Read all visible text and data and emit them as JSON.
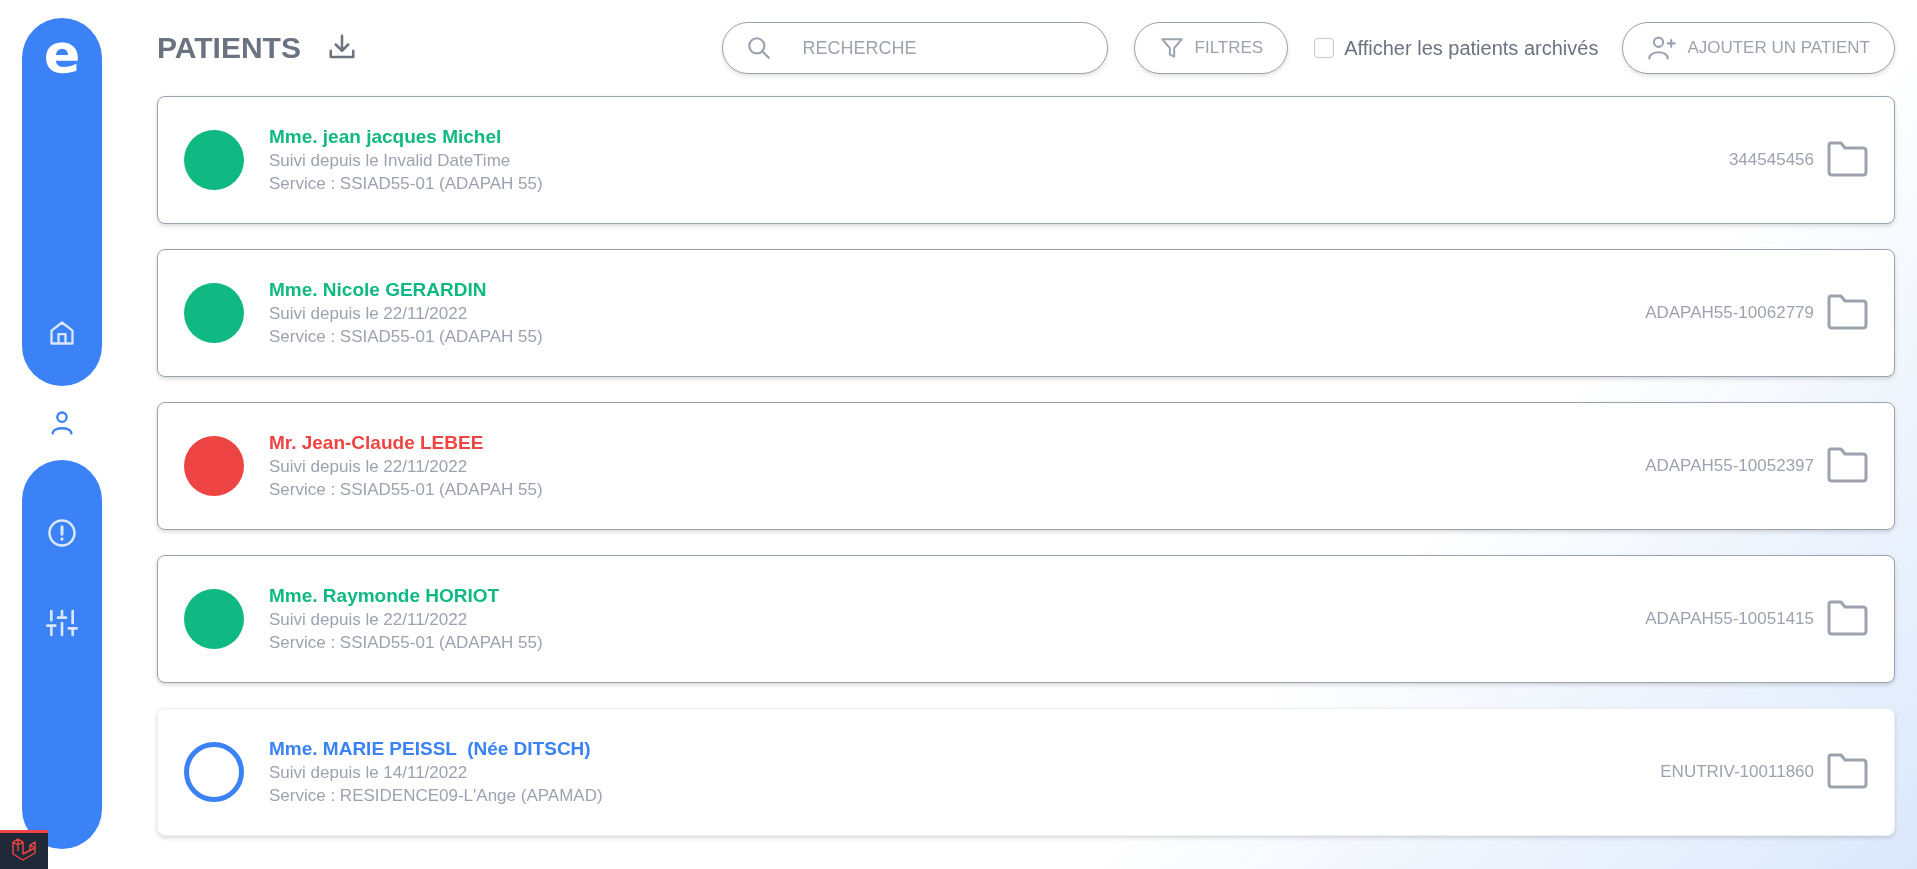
{
  "sidebar": {
    "logo": "e",
    "items": [
      {
        "kind": "home",
        "selected": false
      },
      {
        "kind": "patients",
        "selected": true
      },
      {
        "kind": "alerts",
        "selected": false
      },
      {
        "kind": "settings",
        "selected": false
      }
    ]
  },
  "header": {
    "title": "PATIENTS",
    "search": {
      "placeholder": "RECHERCHE"
    },
    "filters_button": "FILTRES",
    "show_archived": {
      "label": "Afficher les patients archivés",
      "checked": false
    },
    "add_button": "AJOUTER UN PATIENT"
  },
  "patients": [
    {
      "name": "Mme. jean jacques Michel",
      "since": "Suivi depuis le Invalid DateTime",
      "service": "Service : SSIAD55-01 (ADAPAH 55)",
      "id": "344545456",
      "kind": "filled",
      "color": "#10b981"
    },
    {
      "name": "Mme. Nicole GERARDIN",
      "since": "Suivi depuis le 22/11/2022",
      "service": "Service : SSIAD55-01 (ADAPAH 55)",
      "id": "ADAPAH55-10062779",
      "kind": "filled",
      "color": "#10b981"
    },
    {
      "name": "Mr. Jean-Claude LEBEE",
      "since": "Suivi depuis le 22/11/2022",
      "service": "Service : SSIAD55-01 (ADAPAH 55)",
      "id": "ADAPAH55-10052397",
      "kind": "filled",
      "color": "#ef4444"
    },
    {
      "name": "Mme. Raymonde HORIOT",
      "since": "Suivi depuis le 22/11/2022",
      "service": "Service : SSIAD55-01 (ADAPAH 55)",
      "id": "ADAPAH55-10051415",
      "kind": "filled",
      "color": "#10b981"
    },
    {
      "name": "Mme. MARIE PEISSL  (Née DITSCH)",
      "since": "Suivi depuis le 14/11/2022",
      "service": "Service : RESIDENCE09-L'Ange (APAMAD)",
      "id": "ENUTRIV-10011860",
      "kind": "ring",
      "color": "#3b82f6"
    }
  ]
}
